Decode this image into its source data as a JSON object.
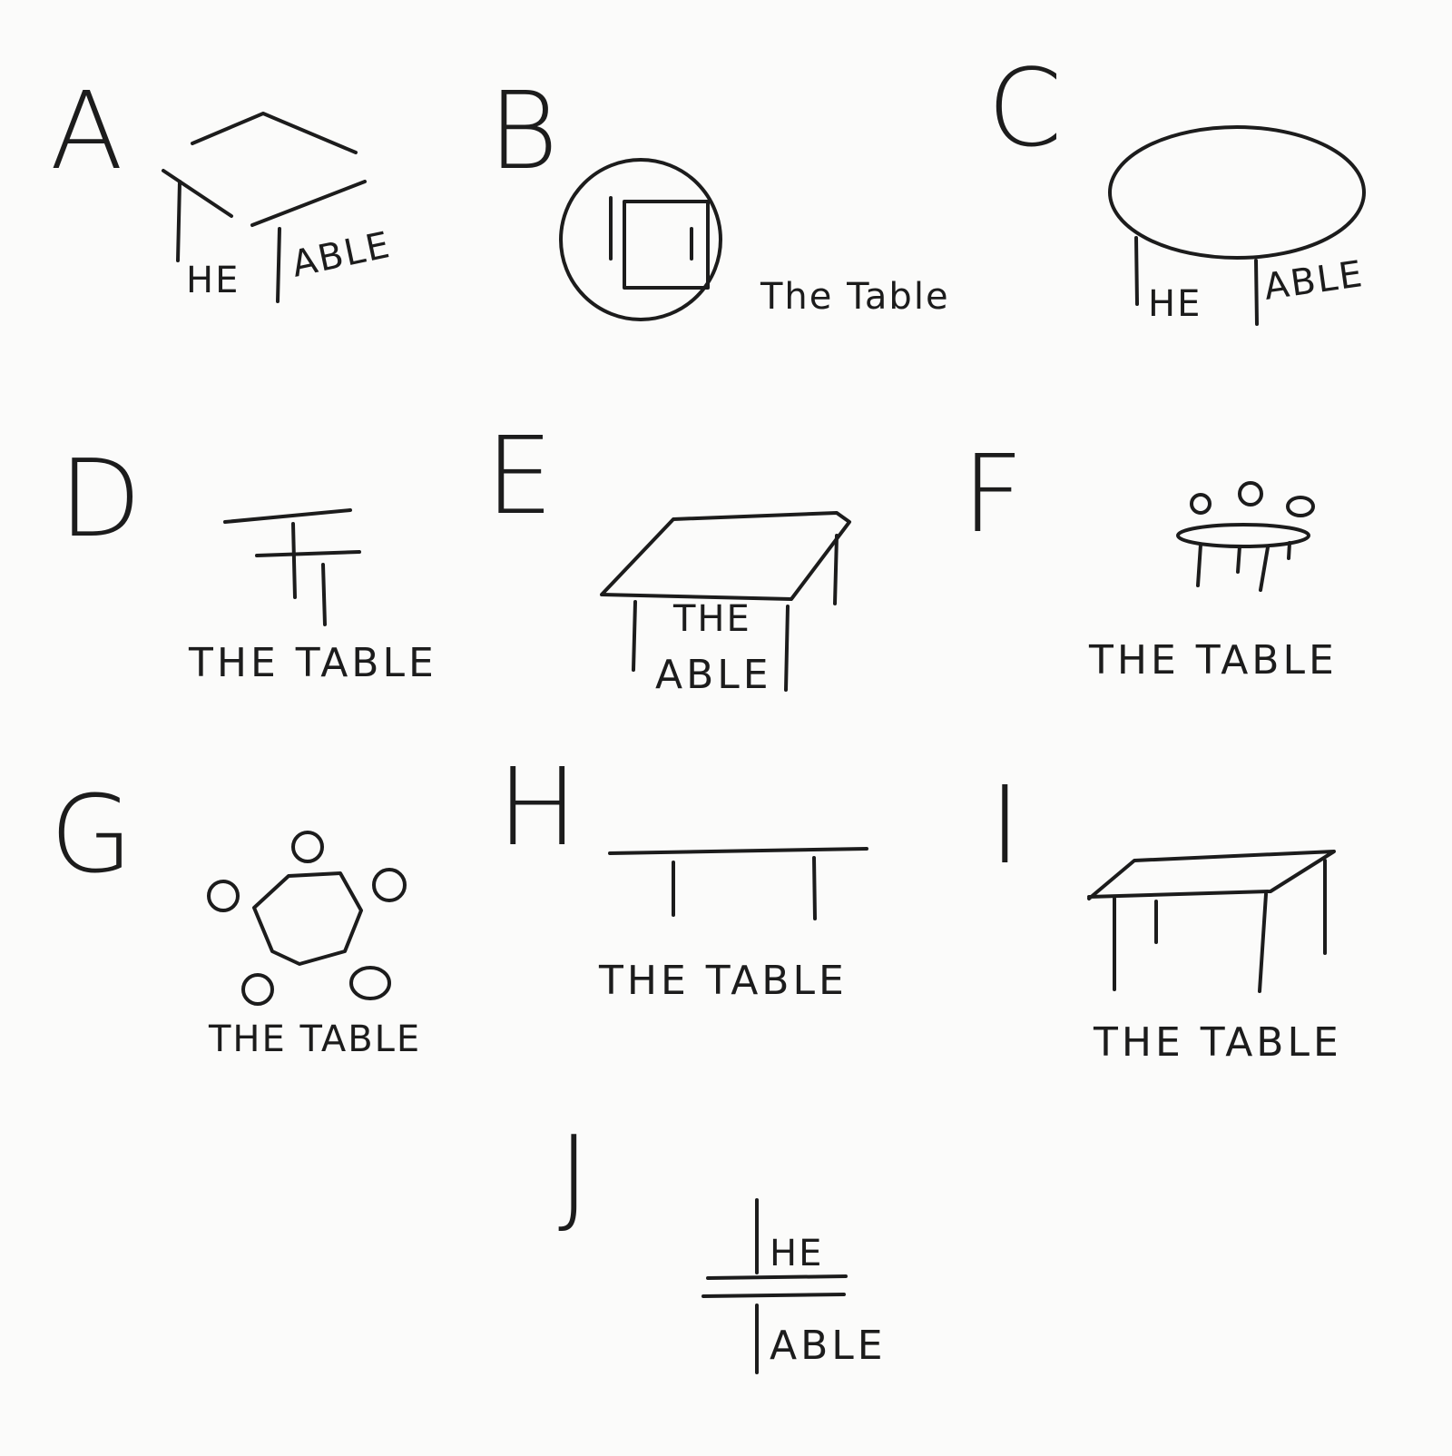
{
  "sketches": [
    {
      "letter": "A",
      "caption_left": "HE",
      "caption_right": "ABLE"
    },
    {
      "letter": "B",
      "caption": "The Table"
    },
    {
      "letter": "C",
      "caption_left": "HE",
      "caption_right": "ABLE"
    },
    {
      "letter": "D",
      "caption": "THE TABLE"
    },
    {
      "letter": "E",
      "caption_top": "THE",
      "caption_bottom": "ABLE"
    },
    {
      "letter": "F",
      "caption": "THE TABLE"
    },
    {
      "letter": "G",
      "caption": "THE TABLE"
    },
    {
      "letter": "H",
      "caption": "THE TABLE"
    },
    {
      "letter": "I",
      "caption": "THE TABLE"
    },
    {
      "letter": "J",
      "caption_top": "HE",
      "caption_bottom": "ABLE"
    }
  ]
}
